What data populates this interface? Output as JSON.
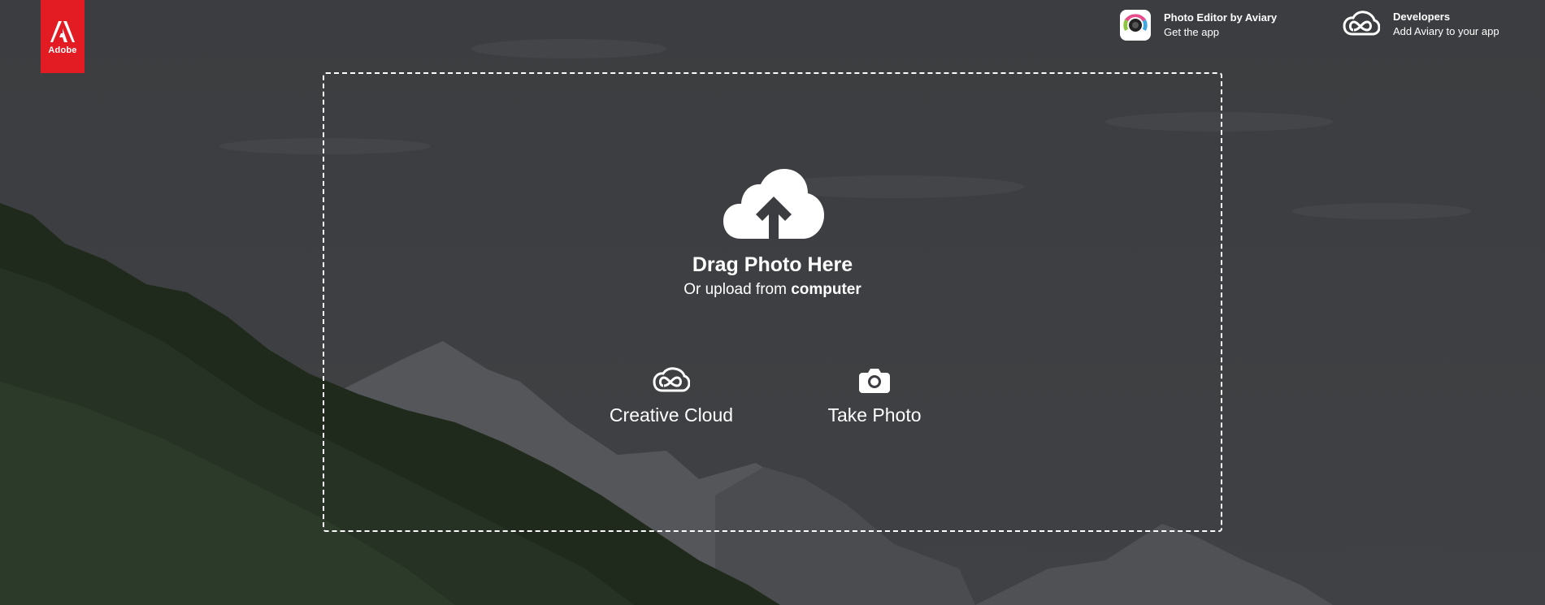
{
  "header": {
    "logo": {
      "text": "Adobe",
      "color": "#e31b23",
      "icon": "adobe-logo-icon"
    },
    "promos": [
      {
        "icon": "aviary-camera-icon",
        "title": "Photo Editor by Aviary",
        "subtitle": "Get the app"
      },
      {
        "icon": "creative-cloud-icon",
        "title": "Developers",
        "subtitle": "Add Aviary to your app"
      }
    ]
  },
  "dropzone": {
    "icon": "cloud-upload-icon",
    "title": "Drag Photo Here",
    "subtitle_prefix": "Or upload from ",
    "subtitle_link": "computer",
    "options": [
      {
        "icon": "creative-cloud-icon",
        "label": "Creative Cloud"
      },
      {
        "icon": "camera-icon",
        "label": "Take Photo"
      }
    ]
  }
}
